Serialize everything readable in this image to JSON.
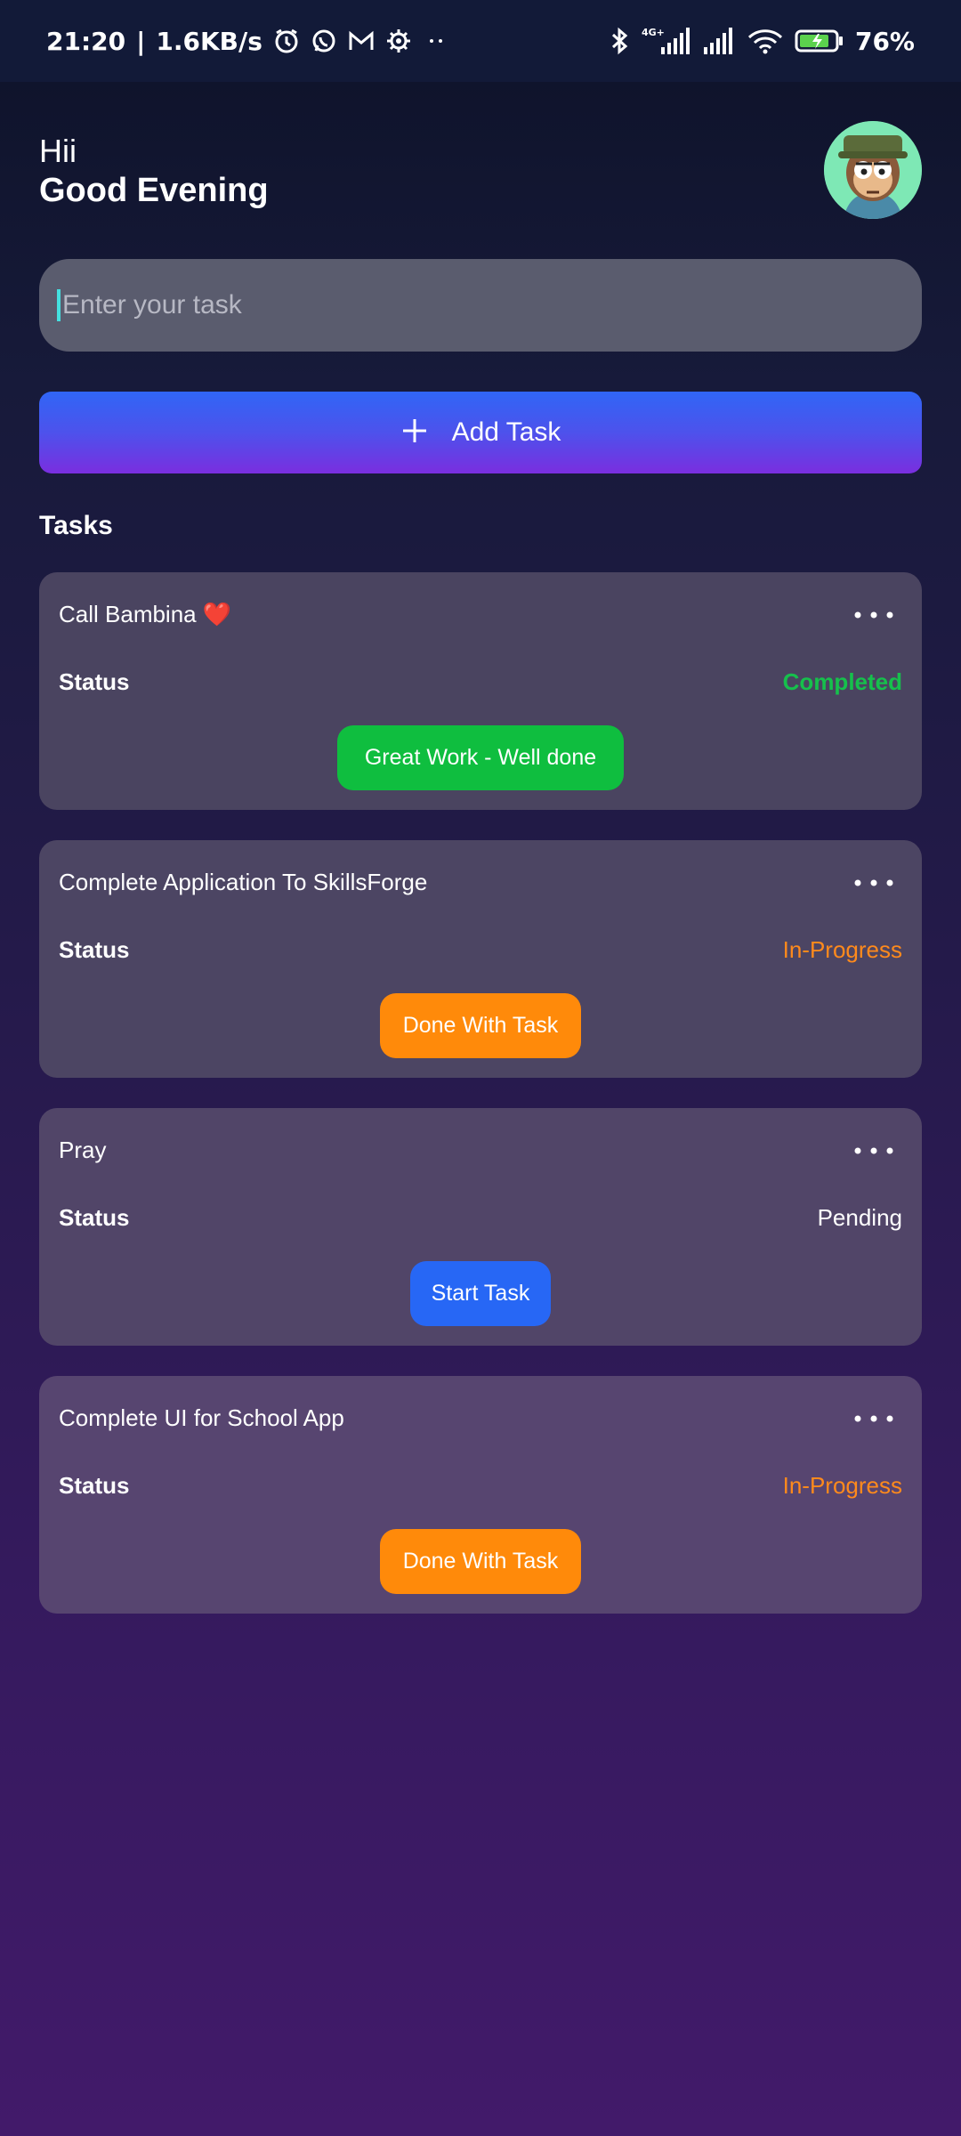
{
  "status_bar": {
    "time": "21:20",
    "speed": "1.6KB/s",
    "battery": "76%",
    "network_label": "4G+",
    "icons": [
      "alarm-icon",
      "whatsapp-icon",
      "gmail-icon",
      "settings-icon",
      "more-icon",
      "bluetooth-icon",
      "signal-icon",
      "signal-icon",
      "wifi-icon",
      "battery-icon"
    ]
  },
  "greeting": {
    "hi": "Hii",
    "time_of_day": "Good Evening"
  },
  "avatar": {
    "icon": "monkey-avatar"
  },
  "task_input": {
    "placeholder": "Enter your task",
    "value": ""
  },
  "add_button": {
    "icon": "plus-icon",
    "label": "Add Task",
    "gradient": [
      "#3066f6",
      "#7a2edf"
    ]
  },
  "tasks_title": "Tasks",
  "tasks": [
    {
      "title": "Call Bambina ❤️",
      "status_label": "Status",
      "status": "Completed",
      "status_color": "#16c04c",
      "action_label": "Great Work - Well done",
      "action_color": "#0fbe3f"
    },
    {
      "title": "Complete Application To SkillsForge",
      "status_label": "Status",
      "status": "In-Progress",
      "status_color": "#ff8a1c",
      "action_label": "Done With Task",
      "action_color": "#ff8a0a"
    },
    {
      "title": "Pray",
      "status_label": "Status",
      "status": "Pending",
      "status_color": "#ffffff",
      "action_label": "Start Task",
      "action_color": "#2767f5"
    },
    {
      "title": "Complete UI for School App",
      "status_label": "Status",
      "status": "In-Progress",
      "status_color": "#ff8a1c",
      "action_label": "Done With Task",
      "action_color": "#ff8a0a"
    }
  ],
  "colors": {
    "card_bg": "#4b4560",
    "input_bg": "#5a5c6e",
    "caret": "#44e0e0"
  }
}
